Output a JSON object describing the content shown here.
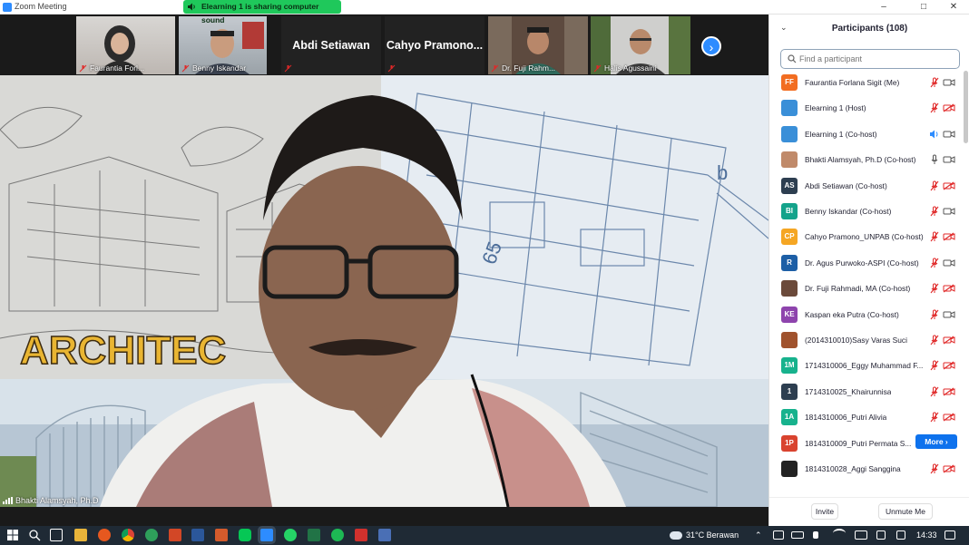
{
  "window": {
    "title": "Zoom Meeting",
    "sharing_banner": "Elearning 1 is sharing computer sound"
  },
  "thumbnails": [
    {
      "name": "Faurantia Forl...",
      "type": "video",
      "muted": true
    },
    {
      "name": "Benny Iskandar",
      "type": "video",
      "muted": true
    },
    {
      "name": "Abdi Setiawan",
      "type": "name",
      "muted": true
    },
    {
      "name": "Cahyo Pramono...",
      "type": "name",
      "muted": true
    },
    {
      "name": "Dr. Fuji Rahm...",
      "type": "video",
      "muted": true
    },
    {
      "name": "Halis Agussaini",
      "type": "video",
      "muted": true
    }
  ],
  "main_video": {
    "speaker": "Bhakti Alamsyah, Ph.D",
    "slide_text": "ARCHITEC"
  },
  "panel": {
    "title": "Participants (108)",
    "search_placeholder": "Find a participant",
    "more_label": "More ›",
    "invite_label": "Invite",
    "unmute_label": "Unmute Me",
    "participants": [
      {
        "initials": "FF",
        "color": "#f26d21",
        "name": "Faurantia Forlana Sigit (Me)",
        "mic": "off",
        "video": "on"
      },
      {
        "initials": "",
        "color": "#3a8fd8",
        "name": "Elearning 1 (Host)",
        "mic": "off",
        "video": "off"
      },
      {
        "initials": "",
        "color": "#3a8fd8",
        "name": "Elearning 1 (Co-host)",
        "mic": "speaking",
        "video": "on"
      },
      {
        "initials": "",
        "color": "#c08a6a",
        "name": "Bhakti Alamsyah, Ph.D (Co-host)",
        "mic": "on",
        "video": "on"
      },
      {
        "initials": "AS",
        "color": "#2d3e50",
        "name": "Abdi Setiawan  (Co-host)",
        "mic": "off",
        "video": "off"
      },
      {
        "initials": "BI",
        "color": "#14a38b",
        "name": "Benny Iskandar (Co-host)",
        "mic": "off",
        "video": "on"
      },
      {
        "initials": "CP",
        "color": "#f5a623",
        "name": "Cahyo Pramono_UNPAB (Co-host)",
        "mic": "off",
        "video": "off"
      },
      {
        "initials": "R",
        "color": "#1d5fa6",
        "name": "Dr. Agus Purwoko-ASPI (Co-host)",
        "mic": "off",
        "video": "on"
      },
      {
        "initials": "",
        "color": "#6b4a3a",
        "name": "Dr. Fuji Rahmadi, MA (Co-host)",
        "mic": "off",
        "video": "off"
      },
      {
        "initials": "KE",
        "color": "#8e44ad",
        "name": "Kaspan  eka Putra (Co-host)",
        "mic": "off",
        "video": "on"
      },
      {
        "initials": "",
        "color": "#a0522d",
        "name": "(2014310010)Sasy Varas Suci",
        "mic": "off",
        "video": "off"
      },
      {
        "initials": "1M",
        "color": "#17b28d",
        "name": "1714310006_Eggy Muhammad F...",
        "mic": "off",
        "video": "off"
      },
      {
        "initials": "1",
        "color": "#2d3e50",
        "name": "1714310025_Khairunnisa",
        "mic": "off",
        "video": "off"
      },
      {
        "initials": "1A",
        "color": "#17b28d",
        "name": "1814310006_Putri Alivia",
        "mic": "off",
        "video": "off"
      },
      {
        "initials": "1P",
        "color": "#d9432f",
        "name": "1814310009_Putri Permata S...",
        "mic": "more",
        "video": "more"
      },
      {
        "initials": "",
        "color": "#222222",
        "name": "1814310028_Aggi Sanggina",
        "mic": "off",
        "video": "off"
      }
    ]
  },
  "taskbar": {
    "weather": "31°C  Berawan",
    "time": "14:33"
  }
}
